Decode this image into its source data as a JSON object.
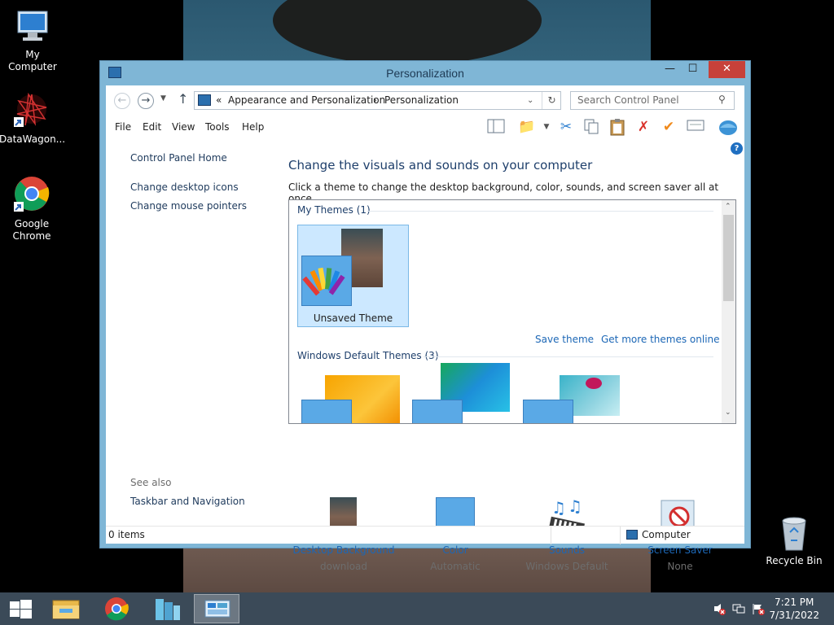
{
  "desktop": {
    "icons": [
      {
        "label": "My Computer"
      },
      {
        "label": "DataWagon..."
      },
      {
        "label": "Google Chrome"
      },
      {
        "label": "Recycle Bin"
      }
    ]
  },
  "window": {
    "title": "Personalization",
    "buttons": {
      "minimize": "—",
      "maximize": "☐",
      "close": "✕"
    },
    "address": {
      "prefix": "«",
      "crumb1": "Appearance and Personalization",
      "sep": "›",
      "crumb2": "Personalization"
    },
    "search": {
      "placeholder": "Search Control Panel"
    },
    "menu": [
      "File",
      "Edit",
      "View",
      "Tools",
      "Help"
    ],
    "sidebar": {
      "home": "Control Panel Home",
      "links": [
        "Change desktop icons",
        "Change mouse pointers"
      ],
      "see_also": "See also",
      "see_also_links": [
        "Taskbar and Navigation"
      ]
    },
    "main": {
      "heading": "Change the visuals and sounds on your computer",
      "subheading": "Click a theme to change the desktop background, color, sounds, and screen saver all at once.",
      "groups": {
        "my_themes": "My Themes (1)",
        "default_themes": "Windows Default Themes (3)"
      },
      "theme_name": "Unsaved Theme",
      "save_theme": "Save theme",
      "get_more": "Get more themes online"
    },
    "bottom": [
      {
        "label": "Desktop Background",
        "value": "download"
      },
      {
        "label": "Color",
        "value": "Automatic"
      },
      {
        "label": "Sounds",
        "value": "Windows Default"
      },
      {
        "label": "Screen Saver",
        "value": "None"
      }
    ],
    "status": {
      "items": "0 items",
      "location": "Computer"
    }
  },
  "taskbar": {
    "time": "7:21 PM",
    "date": "7/31/2022"
  },
  "colors": {
    "window_frame": "#7fb6d6",
    "close_button": "#c7413a",
    "link": "#1c67b6",
    "selected_tile": "#cce8ff",
    "taskbar": "#3b4a58"
  }
}
